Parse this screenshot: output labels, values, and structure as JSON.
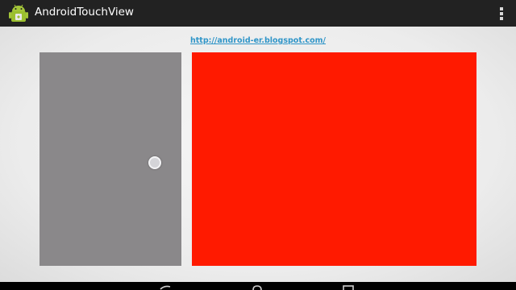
{
  "action_bar": {
    "title": "AndroidTouchView",
    "app_icon": "android-icon",
    "menu_icon": "overflow-menu-icon",
    "background": "#222222"
  },
  "content": {
    "link_text": "http://android-er.blogspot.com/",
    "left_panel_color": "#8a888a",
    "right_panel_color": "#ff1a00"
  },
  "nav_bar": {
    "back_icon": "back-icon",
    "home_icon": "home-icon",
    "recents_icon": "recents-icon"
  }
}
